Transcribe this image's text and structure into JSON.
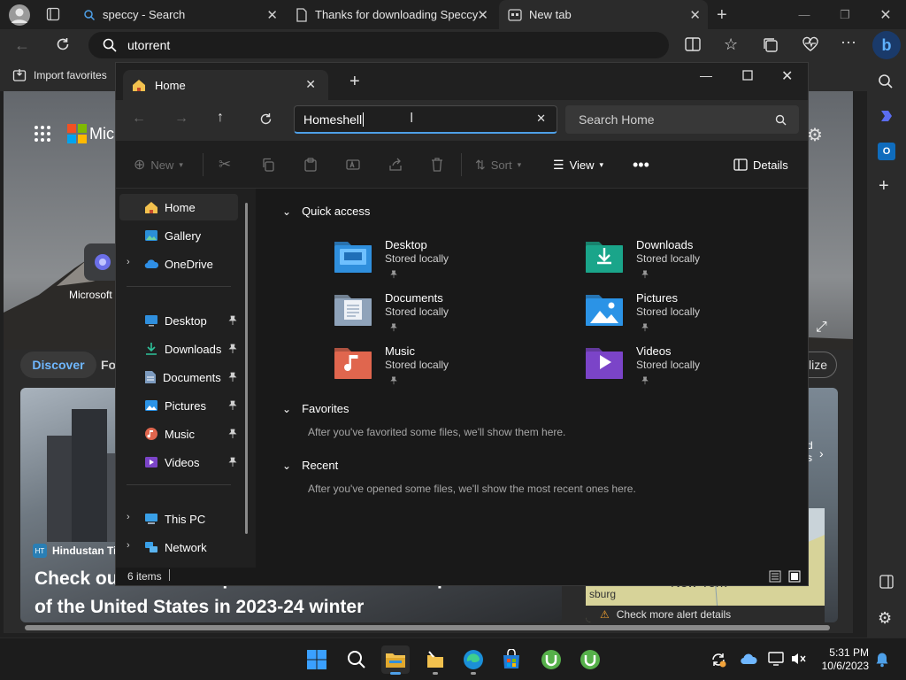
{
  "browser": {
    "tabs": [
      {
        "label": "speccy - Search"
      },
      {
        "label": "Thanks for downloading Speccy"
      },
      {
        "label": "New tab"
      }
    ],
    "address": "utorrent",
    "favorites_label": "Import favorites"
  },
  "ntp": {
    "app_label_partial": "Mic",
    "shortcut_label": "Microsoft",
    "tab_discover": "Discover",
    "tab_following_partial": "Fo",
    "personalize_partial": "lize",
    "news_source": "Hindustan Ti",
    "headline_line1": "Check out the winter predictions for different parts",
    "headline_line2": "of the United States in 2023-24 winter",
    "weather_city": "New York",
    "weather_place_partial": "sburg",
    "weather_alert": "Check more alert details",
    "weather_side_text": "d\ns"
  },
  "explorer": {
    "tab_title": "Home",
    "path_value": "Homeshell",
    "search_placeholder": "Search Home",
    "toolbar": {
      "new": "New",
      "sort": "Sort",
      "view": "View",
      "details": "Details"
    },
    "nav": [
      {
        "label": "Home"
      },
      {
        "label": "Gallery"
      },
      {
        "label": "OneDrive"
      },
      {
        "label": "Desktop"
      },
      {
        "label": "Downloads"
      },
      {
        "label": "Documents"
      },
      {
        "label": "Pictures"
      },
      {
        "label": "Music"
      },
      {
        "label": "Videos"
      },
      {
        "label": "This PC"
      },
      {
        "label": "Network"
      }
    ],
    "sections": {
      "quick_access": "Quick access",
      "favorites": "Favorites",
      "favorites_note": "After you've favorited some files, we'll show them here.",
      "recent": "Recent",
      "recent_note": "After you've opened some files, we'll show the most recent ones here."
    },
    "quick_items": [
      {
        "name": "Desktop",
        "status": "Stored locally",
        "icon": "desktop-folder-icon",
        "color": "#2f8fdd"
      },
      {
        "name": "Downloads",
        "status": "Stored locally",
        "icon": "downloads-folder-icon",
        "color": "#1aa58a"
      },
      {
        "name": "Documents",
        "status": "Stored locally",
        "icon": "documents-folder-icon",
        "color": "#8fa3ba"
      },
      {
        "name": "Pictures",
        "status": "Stored locally",
        "icon": "pictures-folder-icon",
        "color": "#2b93e6"
      },
      {
        "name": "Music",
        "status": "Stored locally",
        "icon": "music-folder-icon",
        "color": "#e0664e"
      },
      {
        "name": "Videos",
        "status": "Stored locally",
        "icon": "videos-folder-icon",
        "color": "#7b44c8"
      }
    ],
    "status_text": "6 items"
  },
  "taskbar": {
    "time": "5:31 PM",
    "date": "10/6/2023"
  },
  "colors": {
    "accent": "#4ea0e8",
    "folder_yellow": "#f2c14e"
  }
}
